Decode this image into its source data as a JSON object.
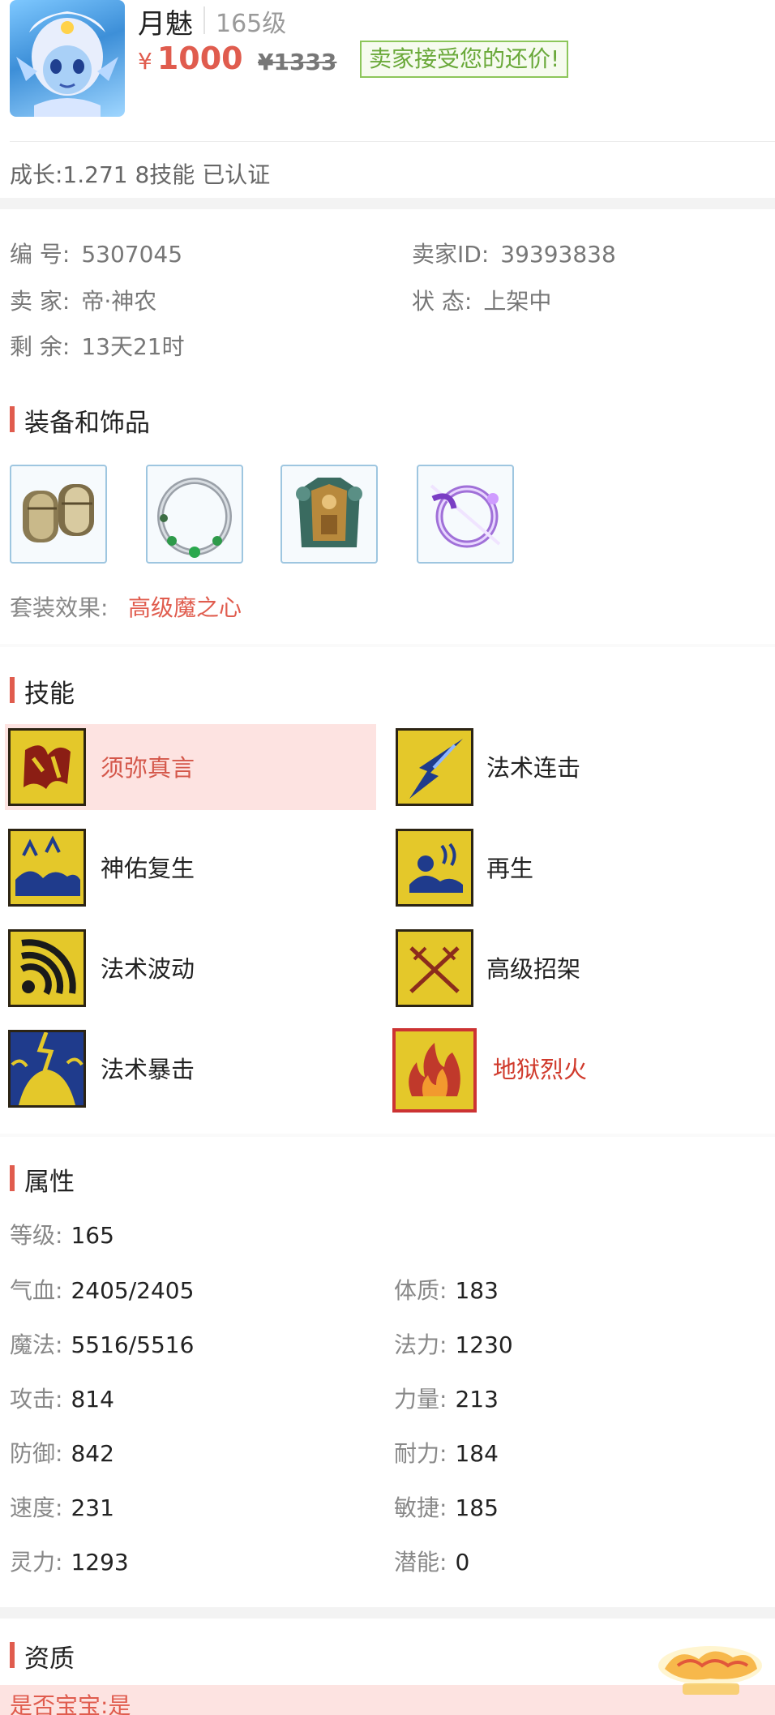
{
  "header": {
    "name": "月魅",
    "level": "165级",
    "price_symbol": "¥",
    "price": "1000",
    "old_price": "¥1333",
    "accept_badge": "卖家接受您的还价!",
    "growth": "成长:1.271 8技能 已认证"
  },
  "info": {
    "id_label": "编 号:",
    "id_value": "5307045",
    "seller_id_label": "卖家ID:",
    "seller_id_value": "39393838",
    "seller_label": "卖 家:",
    "seller_value": "帝·神农",
    "status_label": "状 态:",
    "status_value": "上架中",
    "remain_label": "剩 余:",
    "remain_value": "13天21时"
  },
  "equipment": {
    "title": "装备和饰品",
    "set_label": "套装效果:",
    "set_value": "高级魔之心"
  },
  "skills": {
    "title": "技能",
    "items": [
      {
        "name": "须弥真言",
        "icon": "sumeru-mantra-icon"
      },
      {
        "name": "法术连击",
        "icon": "spell-combo-icon"
      },
      {
        "name": "神佑复生",
        "icon": "divine-revive-icon"
      },
      {
        "name": "再生",
        "icon": "regen-icon"
      },
      {
        "name": "法术波动",
        "icon": "spell-wave-icon"
      },
      {
        "name": "高级招架",
        "icon": "advanced-parry-icon"
      },
      {
        "name": "法术暴击",
        "icon": "spell-crit-icon"
      },
      {
        "name": "地狱烈火",
        "icon": "hellfire-icon"
      }
    ]
  },
  "attributes": {
    "title": "属性",
    "level_label": "等级:",
    "level_value": "165",
    "rows": [
      {
        "k1": "气血:",
        "v1": "2405/2405",
        "k2": "体质:",
        "v2": "183"
      },
      {
        "k1": "魔法:",
        "v1": "5516/5516",
        "k2": "法力:",
        "v2": "1230"
      },
      {
        "k1": "攻击:",
        "v1": "814",
        "k2": "力量:",
        "v2": "213"
      },
      {
        "k1": "防御:",
        "v1": "842",
        "k2": "耐力:",
        "v2": "184"
      },
      {
        "k1": "速度:",
        "v1": "231",
        "k2": "敏捷:",
        "v2": "185"
      },
      {
        "k1": "灵力:",
        "v1": "1293",
        "k2": "潜能:",
        "v2": "0"
      }
    ]
  },
  "aptitude": {
    "title": "资质",
    "is_baby_label": "是否宝宝:",
    "is_baby_value": "是"
  },
  "colors": {
    "accent": "#e05c4e",
    "badge_green": "#6aa93a",
    "highlight_bg": "#fde3e1",
    "skill_gold": "#e9cf2a"
  }
}
